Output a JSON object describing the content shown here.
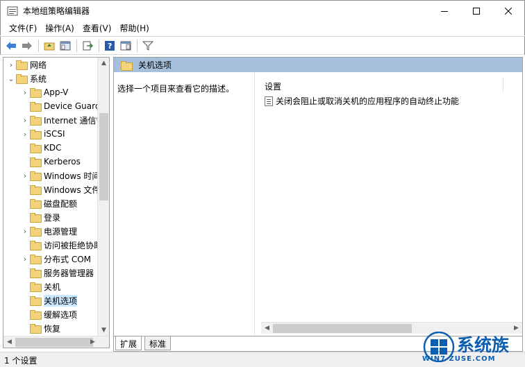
{
  "window": {
    "title": "本地组策略编辑器"
  },
  "menu": [
    {
      "label": "文件(F)"
    },
    {
      "label": "操作(A)"
    },
    {
      "label": "查看(V)"
    },
    {
      "label": "帮助(H)"
    }
  ],
  "toolbar": {
    "icons": [
      "back-arrow-icon",
      "forward-arrow-icon",
      "up-folder-icon",
      "show-tree-icon",
      "export-list-icon",
      "help-icon",
      "show-hide-icon",
      "filter-icon"
    ]
  },
  "tree": {
    "items": [
      {
        "label": "网络",
        "expander": "›"
      },
      {
        "label": "系统",
        "expander": "⌄"
      },
      {
        "label": "App-V",
        "expander": "›"
      },
      {
        "label": "Device Guard",
        "expander": ""
      },
      {
        "label": "Internet 通信管理",
        "expander": "›"
      },
      {
        "label": "iSCSI",
        "expander": "›"
      },
      {
        "label": "KDC",
        "expander": ""
      },
      {
        "label": "Kerberos",
        "expander": ""
      },
      {
        "label": "Windows 时间服务",
        "expander": "›"
      },
      {
        "label": "Windows 文件保护",
        "expander": ""
      },
      {
        "label": "磁盘配额",
        "expander": ""
      },
      {
        "label": "登录",
        "expander": ""
      },
      {
        "label": "电源管理",
        "expander": "›"
      },
      {
        "label": "访问被拒绝协助",
        "expander": ""
      },
      {
        "label": "分布式 COM",
        "expander": "›"
      },
      {
        "label": "服务器管理器",
        "expander": ""
      },
      {
        "label": "关机",
        "expander": ""
      },
      {
        "label": "关机选项",
        "expander": "",
        "selected": true
      },
      {
        "label": "缓解选项",
        "expander": ""
      },
      {
        "label": "恢复",
        "expander": ""
      }
    ]
  },
  "right": {
    "header": "关机选项",
    "description": "选择一个项目来查看它的描述。",
    "column_header": "设置",
    "settings": [
      {
        "label": "关闭会阻止或取消关机的应用程序的自动终止功能"
      }
    ],
    "tabs": [
      {
        "label": "扩展"
      },
      {
        "label": "标准"
      }
    ]
  },
  "status": {
    "text": "1 个设置"
  },
  "watermark": {
    "title": "系统族",
    "url": "WIN7 ZUSE.COM"
  },
  "colors": {
    "header_bg": "#a6c0dc",
    "selected_bg": "#cce8ff",
    "folder": "#f3d37a"
  }
}
